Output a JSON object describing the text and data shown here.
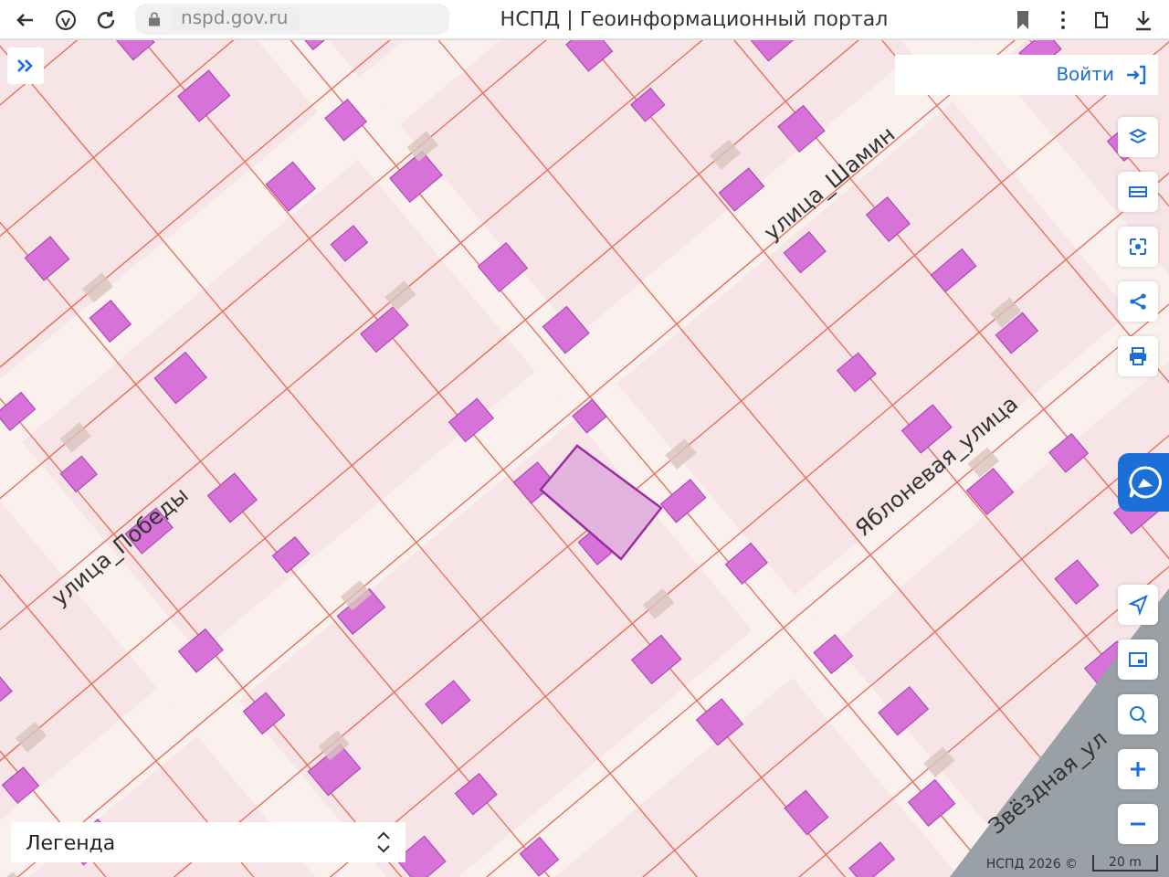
{
  "browser": {
    "url": "nspd.gov.ru",
    "title": "НСПД | Геоинформационный портал"
  },
  "login": {
    "label": "Войти"
  },
  "map": {
    "street_labels": [
      {
        "text": "улица_Победы",
        "kind": "street"
      },
      {
        "text": "улица_Шамин",
        "kind": "street"
      },
      {
        "text": "Яблоневая_улица",
        "kind": "street"
      },
      {
        "text": "Звёздная_ул",
        "kind": "street"
      }
    ],
    "attribution": "НСПД 2026 ©",
    "scale": "20 m"
  },
  "legend": {
    "label": "Легенда"
  }
}
